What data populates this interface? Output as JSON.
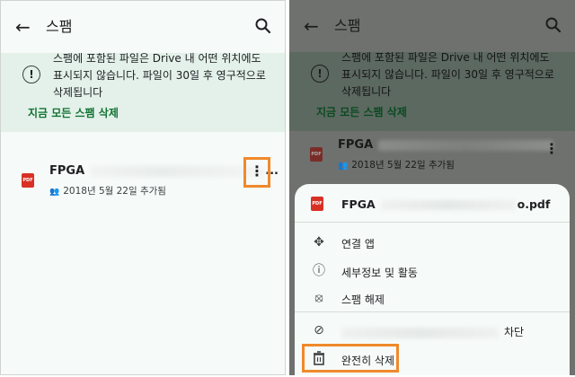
{
  "screen_left": {
    "title": "스팸",
    "back_icon": "back-arrow-icon",
    "search_icon": "search-icon",
    "notice": {
      "icon": "info-icon",
      "line1": "스팸에 포함된 파일은 Drive 내 어떤 위치에도",
      "line2": "표시되지 않습니다. 파일이 30일 후 영구적으로",
      "line3": "삭제됩니다"
    },
    "empty_spam": "지금 모든 스팸 삭제",
    "file": {
      "name_prefix": "FPGA",
      "name_suffix": "...",
      "meta": "2018년 5월 22일 추가됨",
      "pdf_label": "PDF"
    }
  },
  "screen_right": {
    "title": "스팸",
    "notice": {
      "line1": "스팸에 포함된 파일은 Drive 내 어떤 위치에도",
      "line2": "표시되지 않습니다. 파일이 30일 후 영구적으로",
      "line3": "삭제됩니다"
    },
    "empty_spam": "지금 모든 스팸 삭제",
    "file": {
      "name_prefix": "FPGA",
      "meta": "2018년 5월 22일 추가됨"
    },
    "sheet": {
      "file_prefix": "FPGA",
      "file_suffix": "o.pdf",
      "items": [
        {
          "icon": "apps-icon",
          "label": "연결 앱"
        },
        {
          "icon": "info-icon",
          "label": "세부정보 및 활동"
        },
        {
          "icon": "not-spam-icon",
          "label": "스팸 해제"
        },
        {
          "icon": "block-icon",
          "label": "차단"
        },
        {
          "icon": "trash-icon",
          "label": "완전히 삭제"
        }
      ]
    }
  },
  "colors": {
    "accent_green": "#137333",
    "highlight_orange": "#f0892b",
    "pdf_red": "#d93025"
  }
}
